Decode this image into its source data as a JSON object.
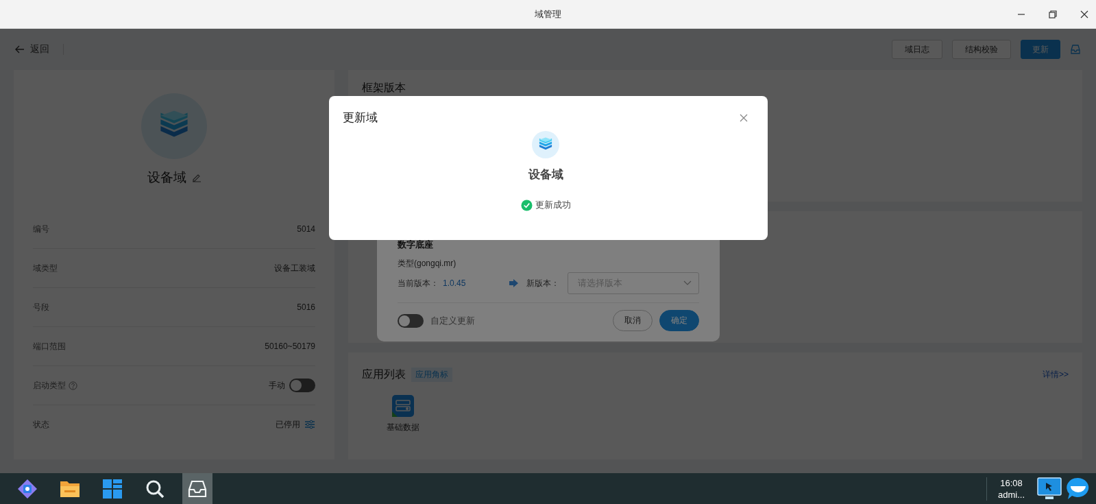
{
  "window": {
    "title": "域管理"
  },
  "toolbar": {
    "back": "返回",
    "buttons": [
      {
        "label": "域日志",
        "primary": false
      },
      {
        "label": "结构校验",
        "primary": false
      },
      {
        "label": "更新",
        "primary": true
      }
    ]
  },
  "domain": {
    "name": "设备域",
    "fields": [
      {
        "label": "编号",
        "value": "5014",
        "kind": "text",
        "help": false
      },
      {
        "label": "域类型",
        "value": "设备工装域",
        "kind": "text",
        "help": false
      },
      {
        "label": "号段",
        "value": "5016",
        "kind": "text",
        "help": false
      },
      {
        "label": "端口范围",
        "value": "50160~50179",
        "kind": "text",
        "help": false
      },
      {
        "label": "启动类型",
        "value": "手动",
        "kind": "toggle",
        "on": false,
        "help": true
      },
      {
        "label": "状态",
        "value": "已停用",
        "kind": "status",
        "help": false
      }
    ]
  },
  "framework_panel": {
    "title": "框架版本"
  },
  "app_list": {
    "title": "应用列表",
    "tag": "应用角标",
    "details_link": "详情>>",
    "apps": [
      {
        "name": "基础数据"
      }
    ]
  },
  "update_dialog": {
    "title": "数字底座",
    "type": "类型(gongqi.mr)",
    "current_label": "当前版本：",
    "current_version": "1.0.45",
    "new_label": "新版本：",
    "new_placeholder": "请选择版本",
    "custom_update": {
      "label": "自定义更新",
      "on": false
    },
    "buttons": [
      {
        "label": "取消",
        "primary": false
      },
      {
        "label": "确定",
        "primary": true
      }
    ]
  },
  "result_modal": {
    "title": "更新域",
    "domain": "设备域",
    "status": "更新成功"
  },
  "taskbar": {
    "apps": [
      {
        "kind": "logo",
        "selected": false
      },
      {
        "kind": "folder",
        "selected": false
      },
      {
        "kind": "tiles",
        "selected": false
      },
      {
        "kind": "search",
        "selected": false
      },
      {
        "kind": "inbox",
        "selected": true
      }
    ],
    "time": "16:08",
    "user": "admi..."
  }
}
